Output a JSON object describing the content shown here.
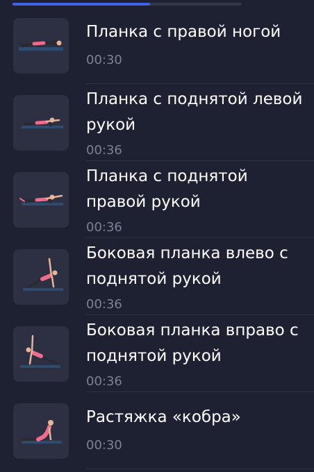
{
  "progress": {
    "fraction": 0.6
  },
  "colors": {
    "background": "#1e2132",
    "progress_accent": "#3f63e6",
    "title_text": "#ffffff",
    "duration_text": "#7d8196",
    "thumbnail_bg": "#2c3042",
    "mat": "#2f4c6e",
    "clothing": "#f06b8c"
  },
  "exercises": [
    {
      "title": "Планка с правой ногой",
      "duration": "00:30",
      "illustration": "plank-leg-raise-figure"
    },
    {
      "title": "Планка с поднятой левой рукой",
      "duration": "00:36",
      "illustration": "plank-arm-raise-figure"
    },
    {
      "title": "Планка с поднятой правой рукой",
      "duration": "00:36",
      "illustration": "plank-arm-raise-figure"
    },
    {
      "title": "Боковая планка влево с поднятой рукой",
      "duration": "00:36",
      "illustration": "side-plank-figure"
    },
    {
      "title": "Боковая планка вправо с поднятой рукой",
      "duration": "00:36",
      "illustration": "side-plank-figure"
    },
    {
      "title": "Растяжка «кобра»",
      "duration": "00:30",
      "illustration": "cobra-stretch-figure"
    }
  ]
}
